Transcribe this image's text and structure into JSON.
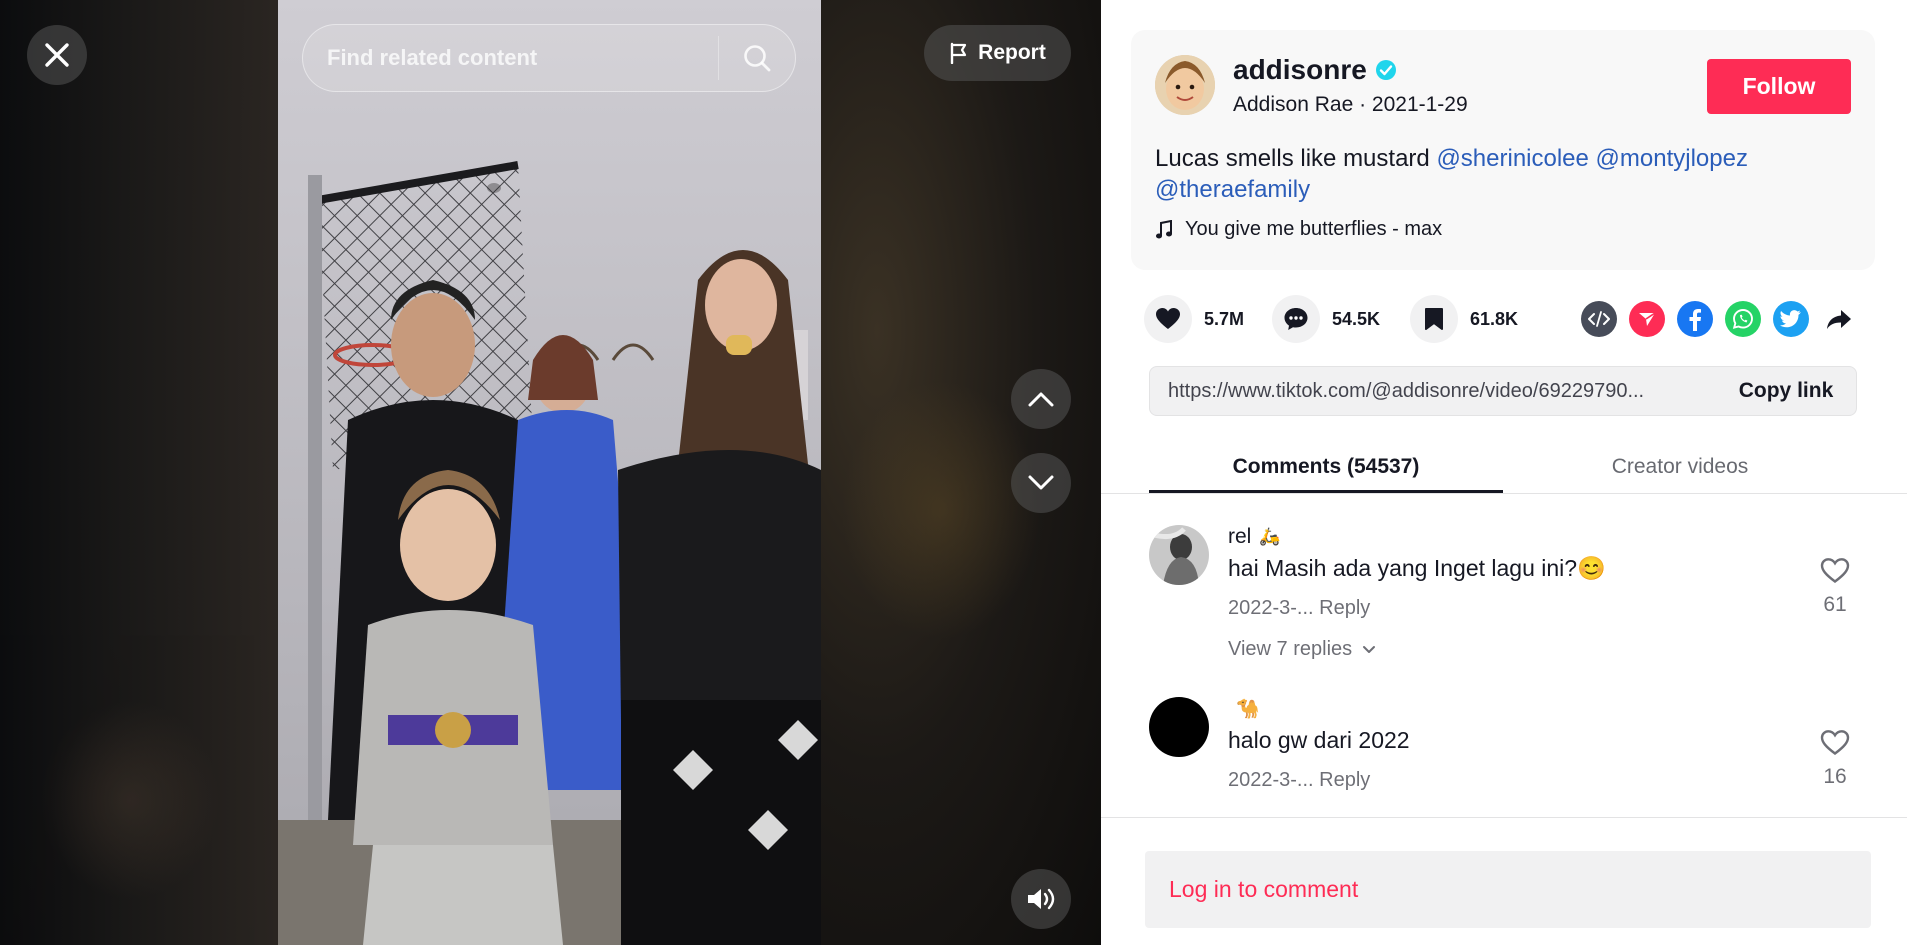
{
  "video": {
    "search_placeholder": "Find related content",
    "report_label": "Report"
  },
  "author": {
    "username": "addisonre",
    "display_name": "Addison  Rae",
    "date": "2021-1-29",
    "follow_label": "Follow"
  },
  "description": {
    "text": "Lucas smells like mustard ",
    "mentions": [
      "@sherinicolee",
      "@montyjlopez",
      "@theraefamily"
    ]
  },
  "music": "You give me butterflies - max",
  "stats": {
    "likes": "5.7M",
    "comments": "54.5K",
    "saves": "61.8K"
  },
  "share": {
    "icons": [
      "embed-icon",
      "send-icon",
      "facebook-icon",
      "whatsapp-icon",
      "twitter-icon",
      "share-arrow-icon"
    ],
    "colors": {
      "embed": "#474c59",
      "send": "#fe2c55",
      "facebook": "#1877f2",
      "whatsapp": "#25d366",
      "twitter": "#1da1f2"
    }
  },
  "link": {
    "url": "https://www.tiktok.com/@addisonre/video/69229790...",
    "copy_label": "Copy link"
  },
  "tabs": {
    "comments": "Comments (54537)",
    "creator": "Creator videos"
  },
  "comments": [
    {
      "user": "rel",
      "user_emoji": "🛵",
      "text": "hai Masih ada yang Inget lagu ini?😊",
      "date": "2022-3-...",
      "reply": "Reply",
      "likes": "61",
      "view_replies": "View 7 replies"
    },
    {
      "user": "",
      "user_emoji": "🐪",
      "text": "halo gw dari 2022",
      "date": "2022-3-...",
      "reply": "Reply",
      "likes": "16"
    }
  ],
  "login_label": "Log in to comment",
  "colors": {
    "accent": "#fe2c55",
    "mention": "#2b5db9",
    "verified": "#20d5ec"
  }
}
